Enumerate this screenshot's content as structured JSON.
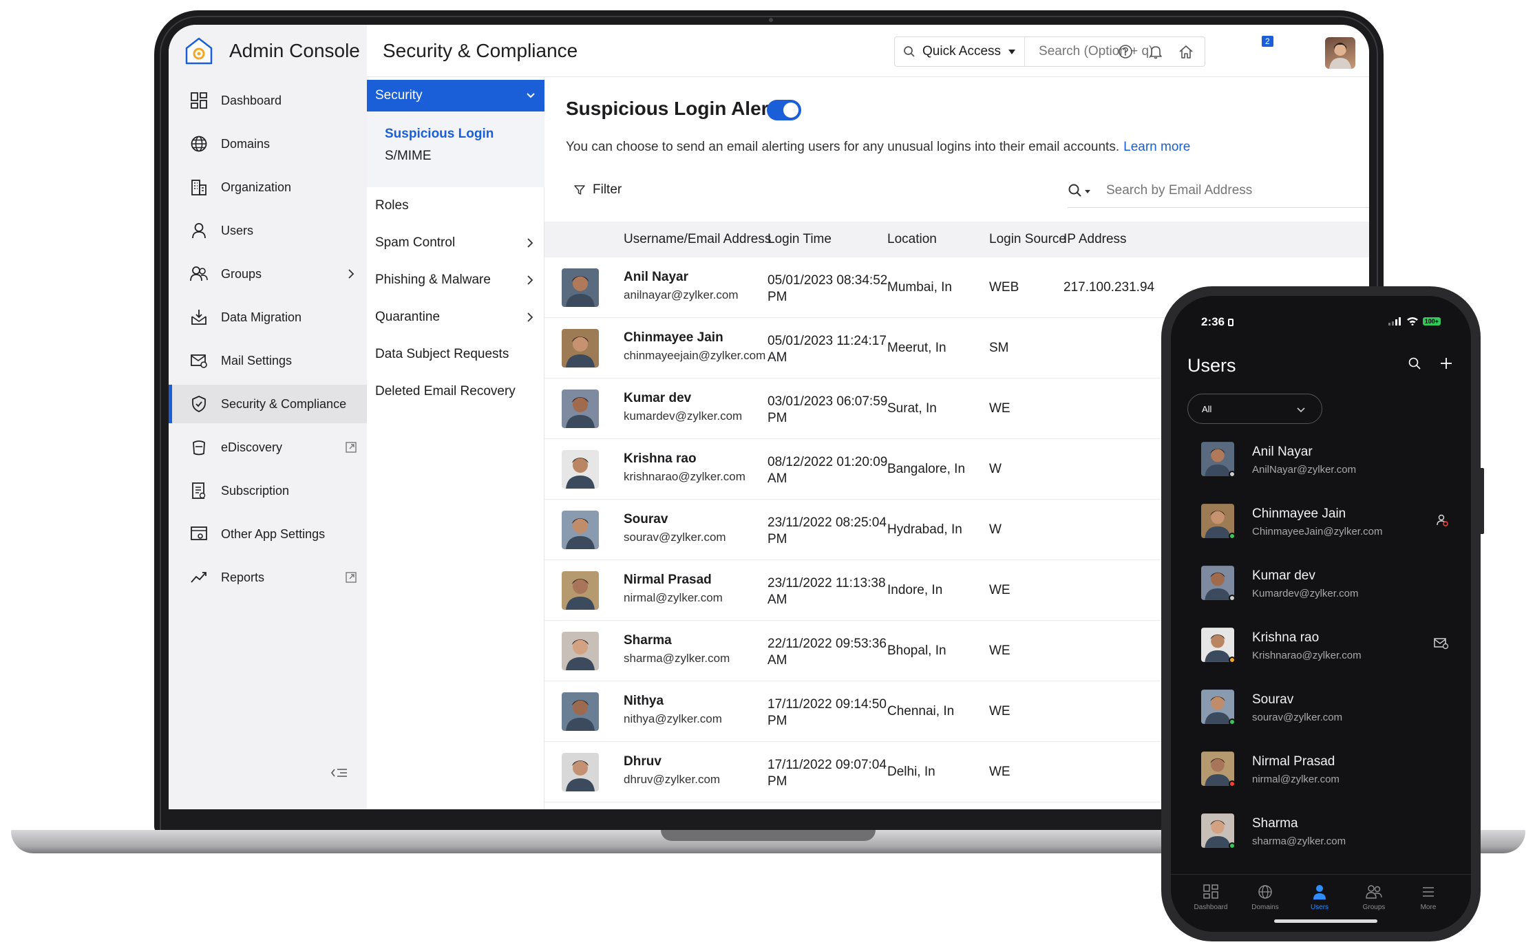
{
  "app": {
    "brand": "Admin Console",
    "page_title": "Security & Compliance"
  },
  "header": {
    "quick_access": "Quick Access",
    "search_placeholder": "Search (Option + q)",
    "notification_count": "2"
  },
  "sidebar": {
    "items": [
      {
        "label": "Dashboard",
        "icon": "dashboard-icon"
      },
      {
        "label": "Domains",
        "icon": "globe-icon"
      },
      {
        "label": "Organization",
        "icon": "building-icon"
      },
      {
        "label": "Users",
        "icon": "user-icon"
      },
      {
        "label": "Groups",
        "icon": "group-icon"
      },
      {
        "label": "Data Migration",
        "icon": "migration-icon"
      },
      {
        "label": "Mail Settings",
        "icon": "mail-settings-icon"
      },
      {
        "label": "Security & Compliance",
        "icon": "shield-icon",
        "active": true
      },
      {
        "label": "eDiscovery",
        "icon": "ediscovery-icon"
      },
      {
        "label": "Subscription",
        "icon": "subscription-icon"
      },
      {
        "label": "Other App Settings",
        "icon": "app-settings-icon"
      },
      {
        "label": "Reports",
        "icon": "reports-icon"
      }
    ]
  },
  "subnav": {
    "section": "Security",
    "section_items": [
      "Suspicious Login",
      "S/MIME"
    ],
    "items": [
      "Roles",
      "Spam Control",
      "Phishing & Malware",
      "Quarantine",
      "Data Subject Requests",
      "Deleted Email Recovery"
    ]
  },
  "content": {
    "title": "Suspicious Login Alerts",
    "description": "You can choose to send an email alerting users for any unusual logins into their email accounts.",
    "learn_more": "Learn more",
    "filter": "Filter",
    "email_search_placeholder": "Search by Email Address",
    "columns": [
      "Username/Email Address",
      "Login Time",
      "Location",
      "Login Source",
      "IP Address"
    ],
    "rows": [
      {
        "name": "Anil Nayar",
        "email": "anilnayar@zylker.com",
        "time1": "05/01/2023 08:34:52",
        "time2": "PM",
        "location": "Mumbai, In",
        "source": "WEB",
        "ip": "217.100.231.94"
      },
      {
        "name": "Chinmayee Jain",
        "email": "chinmayeejain@zylker.com",
        "time1": "05/01/2023 11:24:17",
        "time2": "AM",
        "location": "Meerut, In",
        "source": "SM",
        "ip": ""
      },
      {
        "name": "Kumar dev",
        "email": "kumardev@zylker.com",
        "time1": "03/01/2023 06:07:59",
        "time2": "PM",
        "location": "Surat, In",
        "source": "WE",
        "ip": ""
      },
      {
        "name": "Krishna rao",
        "email": "krishnarao@zylker.com",
        "time1": "08/12/2022 01:20:09",
        "time2": "AM",
        "location": "Bangalore, In",
        "source": "W",
        "ip": ""
      },
      {
        "name": "Sourav",
        "email": "sourav@zylker.com",
        "time1": "23/11/2022 08:25:04",
        "time2": "PM",
        "location": "Hydrabad, In",
        "source": "W",
        "ip": ""
      },
      {
        "name": "Nirmal Prasad",
        "email": "nirmal@zylker.com",
        "time1": "23/11/2022 11:13:38",
        "time2": "AM",
        "location": "Indore, In",
        "source": "WE",
        "ip": ""
      },
      {
        "name": "Sharma",
        "email": "sharma@zylker.com",
        "time1": "22/11/2022 09:53:36",
        "time2": "AM",
        "location": "Bhopal, In",
        "source": "WE",
        "ip": ""
      },
      {
        "name": "Nithya",
        "email": "nithya@zylker.com",
        "time1": "17/11/2022 09:14:50",
        "time2": "PM",
        "location": "Chennai, In",
        "source": "WE",
        "ip": ""
      },
      {
        "name": "Dhruv",
        "email": "dhruv@zylker.com",
        "time1": "17/11/2022 09:07:04",
        "time2": "PM",
        "location": "Delhi, In",
        "source": "WE",
        "ip": ""
      }
    ]
  },
  "phone": {
    "time": "2:36",
    "battery": "100+",
    "title": "Users",
    "filter": "All",
    "users": [
      {
        "name": "Anil Nayar",
        "email": "AnilNayar@zylker.com",
        "status": "#cfcfcf",
        "action": ""
      },
      {
        "name": "Chinmayee Jain",
        "email": "ChinmayeeJain@zylker.com",
        "status": "#34c759",
        "action": "user-block-icon"
      },
      {
        "name": "Kumar dev",
        "email": "Kumardev@zylker.com",
        "status": "#cfcfcf",
        "action": ""
      },
      {
        "name": "Krishna rao",
        "email": "Krishnarao@zylker.com",
        "status": "#f5a623",
        "action": "mail-block-icon"
      },
      {
        "name": "Sourav",
        "email": "sourav@zylker.com",
        "status": "#34c759",
        "action": ""
      },
      {
        "name": "Nirmal Prasad",
        "email": "nirmal@zylker.com",
        "status": "#ff3b30",
        "action": ""
      },
      {
        "name": "Sharma",
        "email": "sharma@zylker.com",
        "status": "#34c759",
        "action": ""
      }
    ],
    "tabs": [
      "Dashboard",
      "Domains",
      "Users",
      "Groups",
      "More"
    ]
  },
  "colors": {
    "accent": "#1a5fd8",
    "phone_bg": "#121214"
  }
}
